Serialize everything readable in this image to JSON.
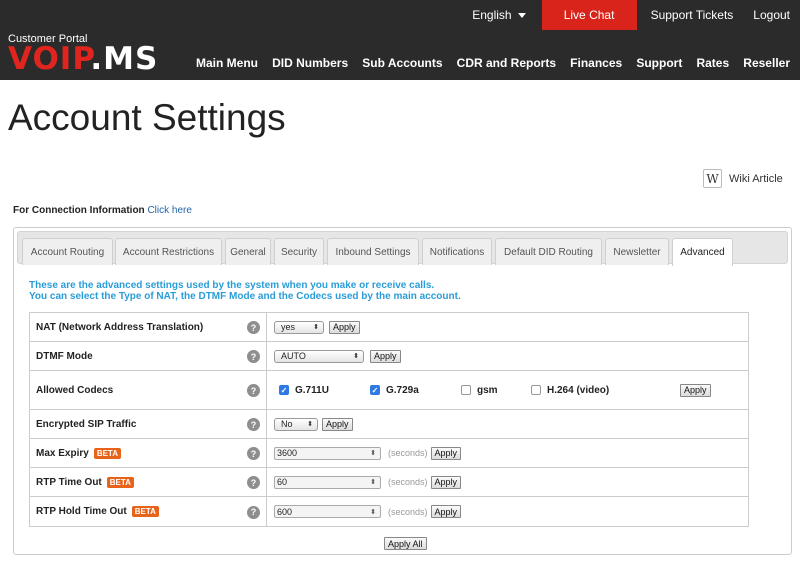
{
  "header": {
    "language": "English",
    "live_chat": "Live Chat",
    "support_tickets": "Support Tickets",
    "logout": "Logout",
    "logo_caption": "Customer Portal",
    "logo_voip": "VOIP",
    "logo_dot": ".",
    "logo_ms": "MS",
    "nav": [
      "Main Menu",
      "DID Numbers",
      "Sub Accounts",
      "CDR and Reports",
      "Finances",
      "Support",
      "Rates",
      "Reseller"
    ]
  },
  "page": {
    "title": "Account Settings",
    "wiki_label": "Wiki Article",
    "connection_label": "For Connection Information",
    "connection_link": "Click here"
  },
  "tabs": [
    {
      "label": "Account Routing",
      "active": false
    },
    {
      "label": "Account Restrictions",
      "active": false
    },
    {
      "label": "General",
      "active": false
    },
    {
      "label": "Security",
      "active": false
    },
    {
      "label": "Inbound Settings",
      "active": false
    },
    {
      "label": "Notifications",
      "active": false
    },
    {
      "label": "Default DID Routing",
      "active": false
    },
    {
      "label": "Newsletter",
      "active": false
    },
    {
      "label": "Advanced",
      "active": true
    }
  ],
  "info": {
    "line1": "These are the advanced settings used by the system when you make or receive calls.",
    "line2": "You can select the Type of NAT, the DTMF Mode and the Codecs used by the main account."
  },
  "settings": {
    "nat": {
      "label": "NAT (Network Address Translation)",
      "value": "yes"
    },
    "dtmf": {
      "label": "DTMF Mode",
      "value": "AUTO"
    },
    "codecs": {
      "label": "Allowed Codecs",
      "items": [
        {
          "name": "G.711U",
          "checked": true
        },
        {
          "name": "G.729a",
          "checked": true
        },
        {
          "name": "gsm",
          "checked": false
        },
        {
          "name": "H.264 (video)",
          "checked": false
        }
      ]
    },
    "encrypted": {
      "label": "Encrypted SIP Traffic",
      "value": "No"
    },
    "max_expiry": {
      "label": "Max Expiry",
      "badge": "BETA",
      "value": "3600",
      "unit": "(seconds)"
    },
    "rtp_timeout": {
      "label": "RTP Time Out",
      "badge": "BETA",
      "value": "60",
      "unit": "(seconds)"
    },
    "rtp_hold": {
      "label": "RTP Hold Time Out",
      "badge": "BETA",
      "value": "600",
      "unit": "(seconds)"
    }
  },
  "buttons": {
    "apply": "Apply",
    "apply_all": "Apply All"
  },
  "icons": {
    "help": "?",
    "wiki": "W",
    "check": "✓",
    "select_arrows": "⬍",
    "spinner": "⬍"
  },
  "colors": {
    "header_bg": "#2b2b2b",
    "live_chat_bg": "#d9241c",
    "info_text": "#2a9dd8",
    "beta_badge": "#e8631a",
    "checkbox_on": "#2e7ae4"
  }
}
